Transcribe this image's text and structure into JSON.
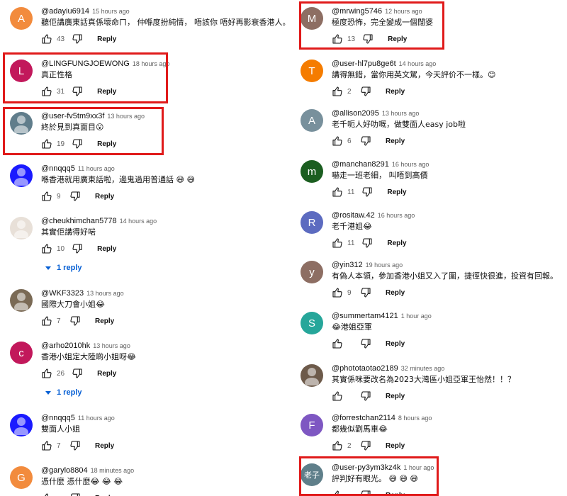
{
  "left_column": [
    {
      "author": "@adayiu6914",
      "time": "15 hours ago",
      "text": "聽佢講廣東話真係壞命ㄇ， 仲喺度扮純情， 唔該你 唔好再影衰香港人。",
      "likes": "43",
      "reply": "Reply",
      "avatar": {
        "letter": "A",
        "color": "#f28b3d"
      }
    },
    {
      "author": "@LINGFUNGJOEWONG",
      "time": "18 hours ago",
      "text": "真正性格",
      "likes": "31",
      "reply": "Reply",
      "avatar": {
        "letter": "L",
        "color": "#c2185b"
      }
    },
    {
      "author": "@user-fv5tm9xx3f",
      "time": "13 hours ago",
      "text": "終於見到真面目😮",
      "likes": "19",
      "reply": "Reply",
      "avatar": {
        "letter": "",
        "color": "#607d8b"
      }
    },
    {
      "author": "@nnqqq5",
      "time": "11 hours ago",
      "text": "喺香港就用廣東話啦，邊鬼過用普通話 😅 😅",
      "likes": "9",
      "reply": "Reply",
      "avatar": {
        "letter": "",
        "color": "#1a1aff"
      }
    },
    {
      "author": "@cheukhimchan5778",
      "time": "14 hours ago",
      "text": "其實佢講得好啱",
      "likes": "10",
      "reply": "Reply",
      "avatar": {
        "letter": "",
        "color": "#e8e0d8"
      },
      "replies": "1 reply"
    },
    {
      "author": "@WKF3323",
      "time": "13 hours ago",
      "text": "國際大刀會小姐😂",
      "likes": "7",
      "reply": "Reply",
      "avatar": {
        "letter": "",
        "color": "#7a6a55"
      }
    },
    {
      "author": "@arho2010hk",
      "time": "13 hours ago",
      "text": "香港小姐定大陸啲小姐呀😂",
      "likes": "26",
      "reply": "Reply",
      "avatar": {
        "letter": "c",
        "color": "#c2185b"
      },
      "replies": "1 reply"
    },
    {
      "author": "@nnqqq5",
      "time": "11 hours ago",
      "text": "雙面人小姐",
      "likes": "7",
      "reply": "Reply",
      "avatar": {
        "letter": "",
        "color": "#1a1aff"
      }
    },
    {
      "author": "@garylo8804",
      "time": "18 minutes ago",
      "text": "憑什麼 憑什麼😂 😂 😂",
      "likes": "",
      "reply": "Reply",
      "avatar": {
        "letter": "G",
        "color": "#f28b3d"
      }
    }
  ],
  "right_column": [
    {
      "author": "@mrwing5746",
      "time": "12 hours ago",
      "text": "極度恐怖，完全變成一個闊婆",
      "likes": "13",
      "reply": "Reply",
      "avatar": {
        "letter": "M",
        "color": "#8d6e63"
      }
    },
    {
      "author": "@user-hl7pu8ge6t",
      "time": "14 hours ago",
      "text": "講得無錯，當你用英文駕，今天評价不一樣。😊",
      "likes": "2",
      "reply": "Reply",
      "avatar": {
        "letter": "T",
        "color": "#f57c00"
      }
    },
    {
      "author": "@allison2095",
      "time": "13 hours ago",
      "text": "老千呃人好叻嘅，做雙面人easy job啦",
      "likes": "6",
      "reply": "Reply",
      "avatar": {
        "letter": "A",
        "color": "#78909c"
      }
    },
    {
      "author": "@manchan8291",
      "time": "16 hours ago",
      "text": "嚇走一班老細，  叫唔到高價",
      "likes": "11",
      "reply": "Reply",
      "avatar": {
        "letter": "m",
        "color": "#1b5e20"
      }
    },
    {
      "author": "@rositaw.42",
      "time": "16 hours ago",
      "text": "老千港姐😂",
      "likes": "11",
      "reply": "Reply",
      "avatar": {
        "letter": "R",
        "color": "#5c6bc0"
      }
    },
    {
      "author": "@yin312",
      "time": "19 hours ago",
      "text": "有偽人本領，參加香港小姐又入了圍，捷徑快很進，投資有回報。",
      "likes": "9",
      "reply": "Reply",
      "avatar": {
        "letter": "y",
        "color": "#8d6e63"
      }
    },
    {
      "author": "@summertam4121",
      "time": "1 hour ago",
      "text": "😂港姐亞軍",
      "likes": "",
      "reply": "Reply",
      "avatar": {
        "letter": "S",
        "color": "#26a69a"
      }
    },
    {
      "author": "@phototaotao2189",
      "time": "32 minutes ago",
      "text": "其實係咪要改名為2023大灣區小姐亞軍王怡然！！？",
      "likes": "",
      "reply": "Reply",
      "avatar": {
        "letter": "",
        "color": "#6d5a4a"
      }
    },
    {
      "author": "@forrestchan2114",
      "time": "8 hours ago",
      "text": "都幾似劉馬車😂",
      "likes": "2",
      "reply": "Reply",
      "avatar": {
        "letter": "F",
        "color": "#7e57c2"
      }
    },
    {
      "author": "@user-py3ym3kz4k",
      "time": "1 hour ago",
      "text": "評判好有眼光。 😅 😅 😅",
      "likes": "",
      "reply": "Reply",
      "avatar": {
        "letter": "老子",
        "color": "#5f7f8a"
      }
    }
  ]
}
